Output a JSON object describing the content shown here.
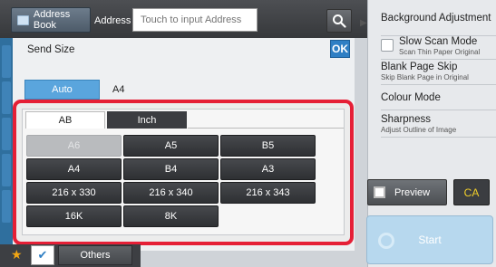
{
  "header": {
    "address_book_label": "Address Book",
    "address_label": "Address",
    "address_placeholder": "Touch to input Address"
  },
  "dialog": {
    "title": "Send Size",
    "ok_label": "OK",
    "auto_label": "Auto",
    "selected_size": "A4"
  },
  "popup": {
    "tabs": [
      "AB",
      "Inch"
    ],
    "active_tab": "AB",
    "sizes": [
      "A6",
      "A5",
      "B5",
      "A4",
      "B4",
      "A3",
      "216 x 330",
      "216 x 340",
      "216 x 343",
      "16K",
      "8K"
    ],
    "disabled_sizes": [
      "A6"
    ]
  },
  "right_panel": {
    "items": [
      {
        "title": "Background Adjustment",
        "subtitle": ""
      },
      {
        "title": "Slow Scan Mode",
        "subtitle": "Scan Thin Paper Original"
      },
      {
        "title": "Blank Page Skip",
        "subtitle": "Skip Blank Page in Original"
      },
      {
        "title": "Colour Mode",
        "subtitle": ""
      },
      {
        "title": "Sharpness",
        "subtitle": "Adjust Outline of Image"
      }
    ],
    "preview_label": "Preview",
    "ca_label": "CA",
    "start_label": "Start"
  },
  "bottom": {
    "others_label": "Others"
  },
  "colors": {
    "accent_blue": "#2f7fc4",
    "highlight_red": "#e51f36",
    "ca_yellow": "#f2cf2a",
    "star_orange": "#f2a614"
  },
  "icons": [
    "book-icon",
    "search-icon",
    "collapse-arrow-icon",
    "checkbox-icon",
    "preview-icon",
    "star-icon",
    "checkmark-icon"
  ]
}
